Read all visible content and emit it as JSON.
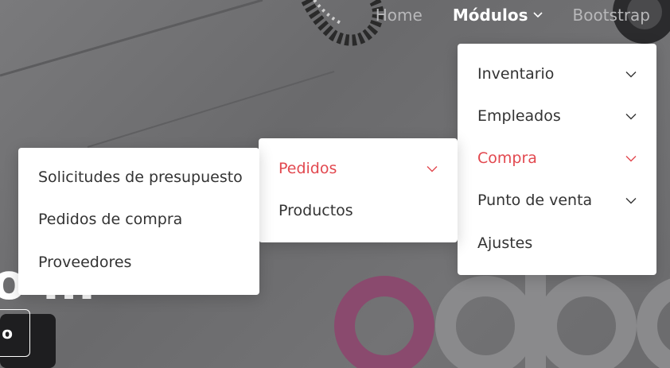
{
  "nav": {
    "items": [
      {
        "label": "Home"
      },
      {
        "label": "Módulos"
      },
      {
        "label": "Bootstrap"
      }
    ]
  },
  "modulos_menu": {
    "items": [
      {
        "label": "Inventario",
        "icon": "chevron-down-icon"
      },
      {
        "label": "Empleados",
        "icon": "chevron-down-icon"
      },
      {
        "label": "Compra",
        "icon": "chevron-down-icon",
        "active": true
      },
      {
        "label": "Punto de venta",
        "icon": "chevron-down-icon"
      },
      {
        "label": "Ajustes"
      }
    ]
  },
  "compra_menu": {
    "items": [
      {
        "label": "Pedidos",
        "icon": "chevron-down-icon",
        "active": true
      },
      {
        "label": "Productos"
      }
    ]
  },
  "pedidos_menu": {
    "items": [
      {
        "label": "Solicitudes de presupuesto"
      },
      {
        "label": "Pedidos de compra"
      },
      {
        "label": "Proveedores"
      }
    ]
  },
  "hero": {
    "title": "o ...",
    "button_label": "o"
  },
  "colors": {
    "accent": "#e2484f",
    "menu_text": "#333333",
    "nav_inactive": "#b8b8ba",
    "nav_active": "#ffffff",
    "odoo_purple": "#8a4a6e",
    "odoo_gray": "#8a8a8c"
  }
}
